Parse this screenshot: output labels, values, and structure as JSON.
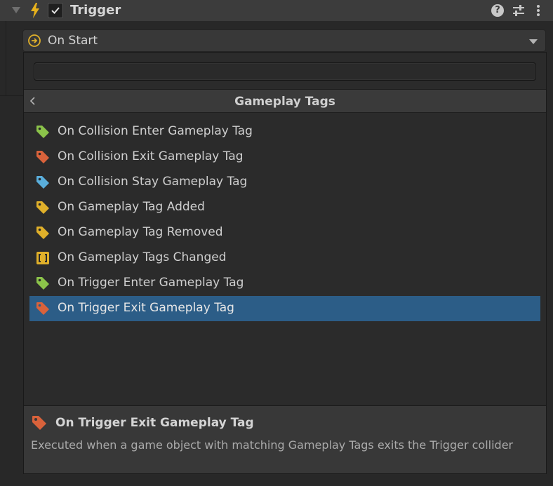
{
  "header": {
    "title": "Trigger",
    "enabled": true,
    "help_glyph": "?"
  },
  "dropdown": {
    "selected": "On Start",
    "icon": "circle-arrow-icon"
  },
  "popup": {
    "search": {
      "value": "",
      "placeholder": ""
    },
    "category_title": "Gameplay Tags",
    "items": [
      {
        "label": "On Collision Enter Gameplay Tag",
        "icon": "tag-icon",
        "color": "#8bc34a"
      },
      {
        "label": "On Collision Exit Gameplay Tag",
        "icon": "tag-icon",
        "color": "#d9623b"
      },
      {
        "label": "On Collision Stay Gameplay Tag",
        "icon": "tag-icon",
        "color": "#5aaedb"
      },
      {
        "label": "On Gameplay Tag Added",
        "icon": "tag-icon",
        "color": "#e0b02a"
      },
      {
        "label": "On Gameplay Tag Removed",
        "icon": "tag-icon",
        "color": "#e0b02a"
      },
      {
        "label": "On Gameplay Tags Changed",
        "icon": "brackets-icon",
        "color": "#e0b02a"
      },
      {
        "label": "On Trigger Enter Gameplay Tag",
        "icon": "tag-icon",
        "color": "#8bc34a"
      },
      {
        "label": "On Trigger Exit Gameplay Tag",
        "icon": "tag-icon",
        "color": "#d9623b",
        "selected": true
      }
    ],
    "description": {
      "title": "On Trigger Exit Gameplay Tag",
      "text": "Executed when a game object with matching Gameplay Tags exits the Trigger collider",
      "color": "#d9623b"
    }
  },
  "colors": {
    "accent_bolt": "#e8b21c",
    "selection": "#2c5d87"
  }
}
